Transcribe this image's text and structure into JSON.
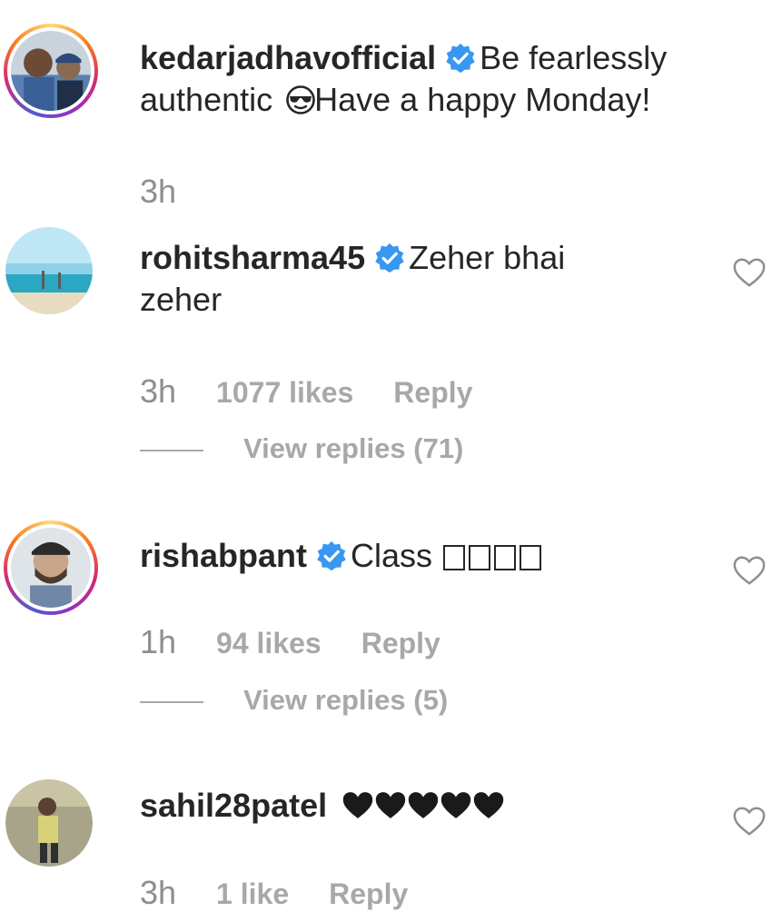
{
  "comments": [
    {
      "username": "kedarjadhavofficial",
      "text_line1": "Be fearlessly",
      "text_line2_a": "authentic",
      "text_line2_b": "Have a happy Monday!",
      "time": "3h"
    },
    {
      "username": "rohitsharma45",
      "text_line1": "Zeher bhai",
      "text_line2": "zeher",
      "time": "3h",
      "likes": "1077 likes",
      "reply": "Reply",
      "view_replies": "View replies (71)"
    },
    {
      "username": "rishabpant",
      "text": "Class",
      "time": "1h",
      "likes": "94 likes",
      "reply": "Reply",
      "view_replies": "View replies (5)"
    },
    {
      "username": "sahil28patel",
      "time": "3h",
      "likes": "1 like",
      "reply": "Reply"
    }
  ],
  "icons": {
    "verified": "verified-badge-icon",
    "like": "heart-outline-icon",
    "emoji_sunglasses": "sunglasses-emoji-icon",
    "emoji_missing": "missing-glyph-box",
    "black_heart": "black-heart-emoji"
  },
  "colors": {
    "verified_blue": "#3897f0",
    "text": "#262626",
    "muted": "#8e8e8e"
  }
}
